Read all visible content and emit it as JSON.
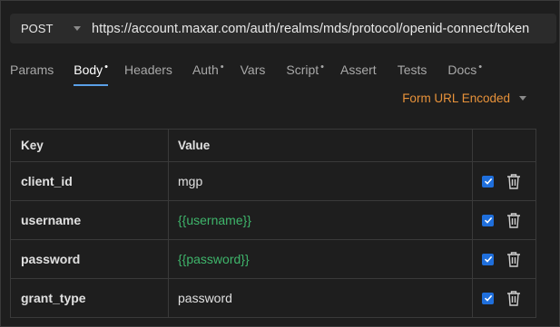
{
  "request": {
    "method": "POST",
    "url": "https://account.maxar.com/auth/realms/mds/protocol/openid-connect/token"
  },
  "tabs": [
    {
      "label": "Params",
      "modified": ""
    },
    {
      "label": "Body",
      "modified": "•"
    },
    {
      "label": "Headers",
      "modified": ""
    },
    {
      "label": "Auth",
      "modified": "•"
    },
    {
      "label": "Vars",
      "modified": ""
    },
    {
      "label": "Script",
      "modified": "•"
    },
    {
      "label": "Assert",
      "modified": ""
    },
    {
      "label": "Tests",
      "modified": ""
    },
    {
      "label": "Docs",
      "modified": "•"
    }
  ],
  "active_tab": "Body",
  "body_mode": "Form URL Encoded",
  "table": {
    "headers": {
      "key": "Key",
      "value": "Value"
    },
    "rows": [
      {
        "key": "client_id",
        "value": "mgp",
        "enabled": true
      },
      {
        "key": "username",
        "value": "{{username}}",
        "enabled": true
      },
      {
        "key": "password",
        "value": "{{password}}",
        "enabled": true
      },
      {
        "key": "grant_type",
        "value": "password",
        "enabled": true
      }
    ]
  },
  "colors": {
    "accent": "#5aa0e6",
    "mode": "#e8923a",
    "variable": "#3fb56b",
    "checkbox": "#1f6fdc"
  }
}
